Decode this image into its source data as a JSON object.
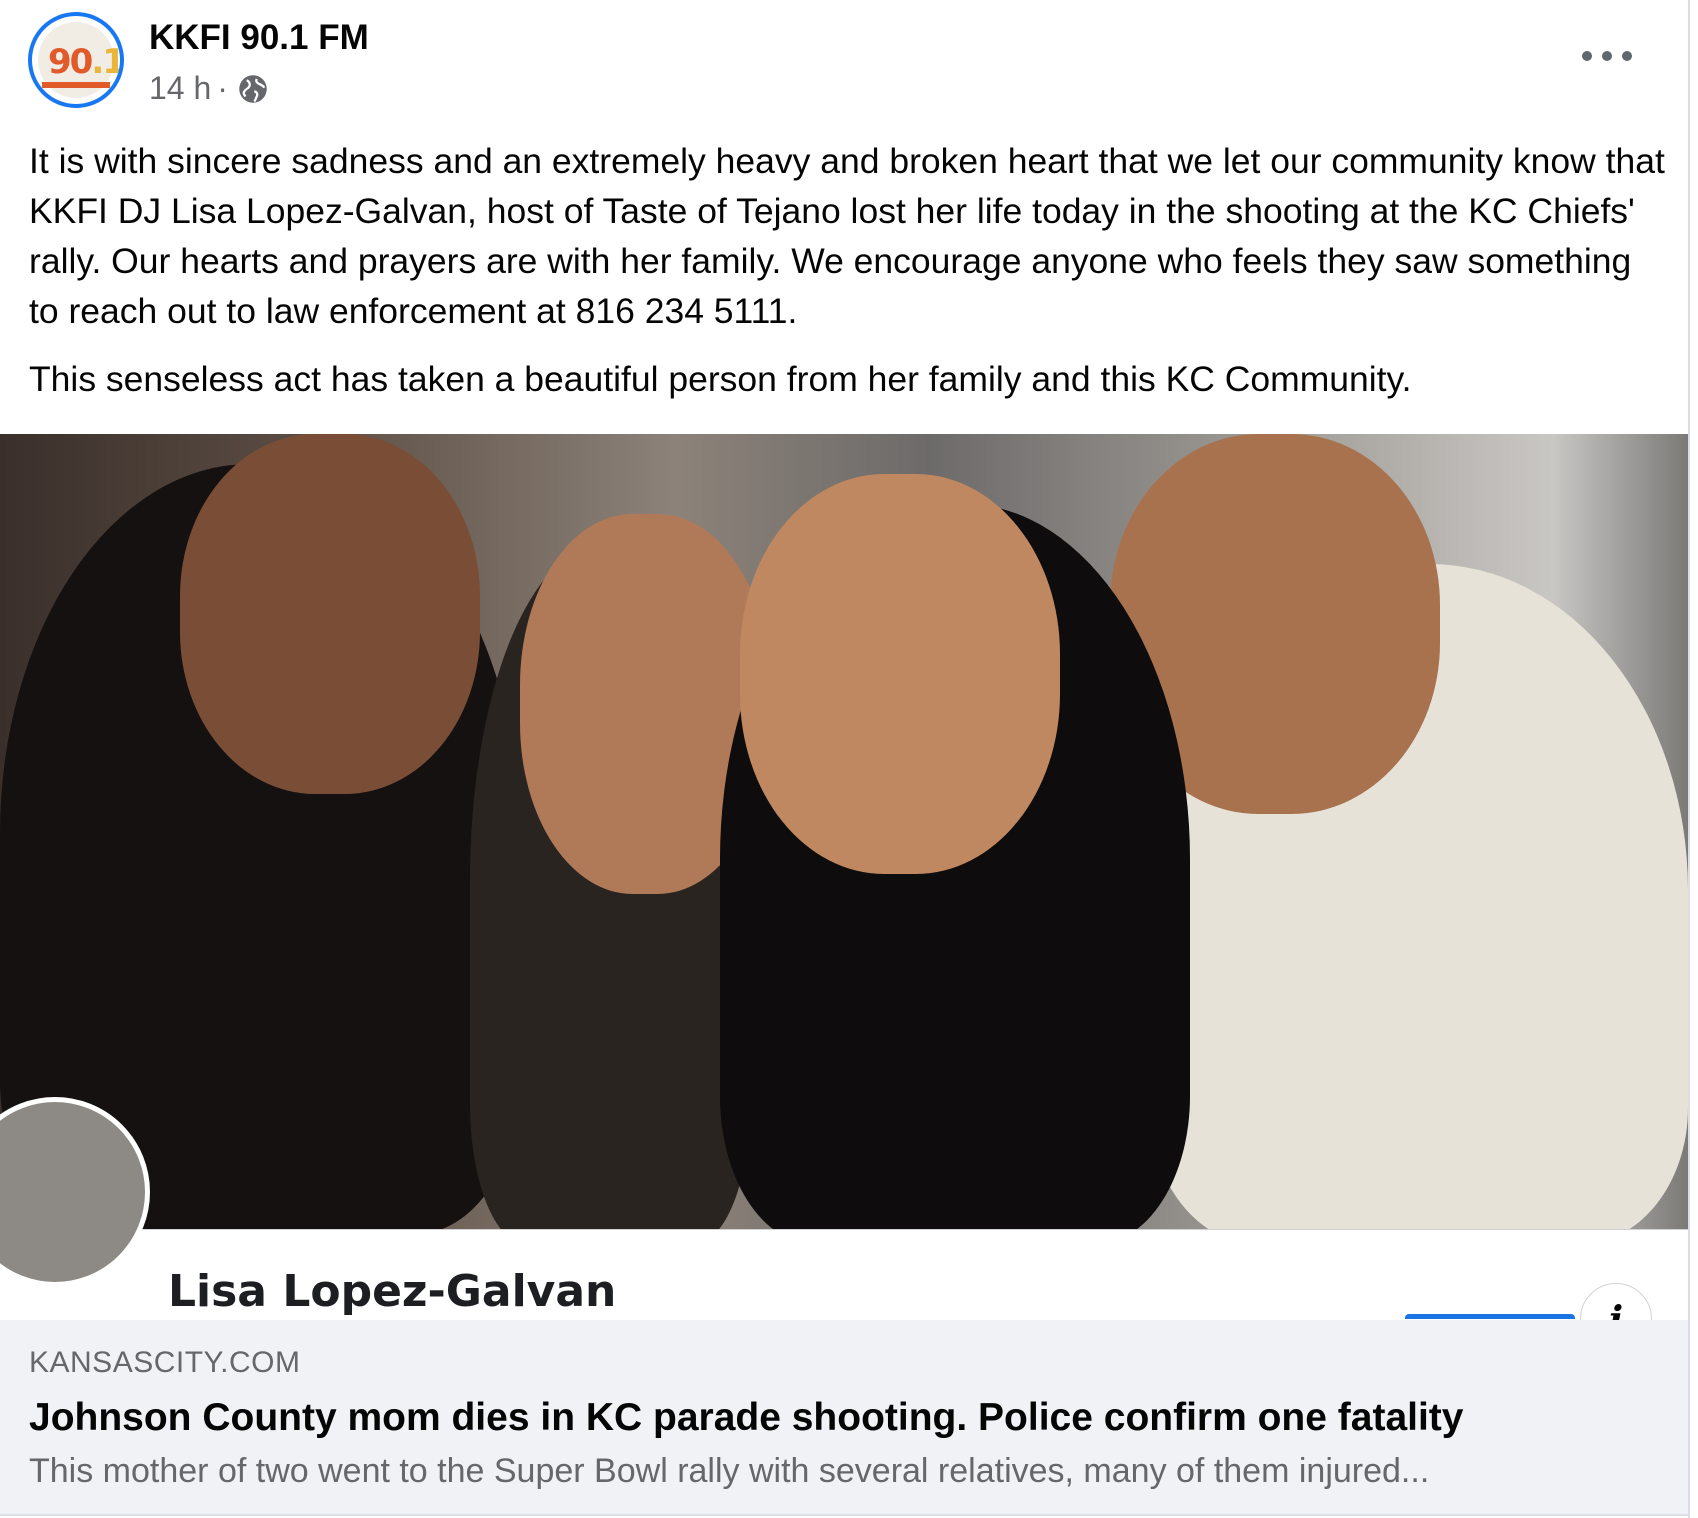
{
  "post": {
    "page_name": "KKFI 90.1 FM",
    "timestamp": "14 h",
    "separator": "·",
    "audience_icon": "globe-icon",
    "avatar": {
      "number_main": "90",
      "number_accent": ".1"
    },
    "more_icon": "more-horizontal-icon",
    "body": {
      "paragraph_1": "It is with sincere sadness and an extremely heavy and broken heart that we let our community know that KKFI DJ Lisa Lopez-Galvan, host of Taste of Tejano lost her life  today in the shooting at the KC Chiefs' rally. Our hearts and prayers are with her family.  We encourage anyone who feels they saw something to reach out to law enforcement at 816 234 5111.",
      "paragraph_2": "This senseless act has taken a beautiful person from her family and this KC Community."
    }
  },
  "link_preview": {
    "image_overlay_name": "Lisa Lopez-Galvan",
    "info_icon": "info-icon",
    "info_glyph": "i",
    "domain": "KANSASCITY.COM",
    "headline": "Johnson County mom dies in KC parade shooting. Police confirm one fatality",
    "description": "This mother of two went to the Super Bowl rally with several relatives, many of them injured..."
  },
  "colors": {
    "accent_blue": "#1877f2",
    "secondary_text": "#65676b",
    "footer_bg": "#f0f2f5"
  }
}
